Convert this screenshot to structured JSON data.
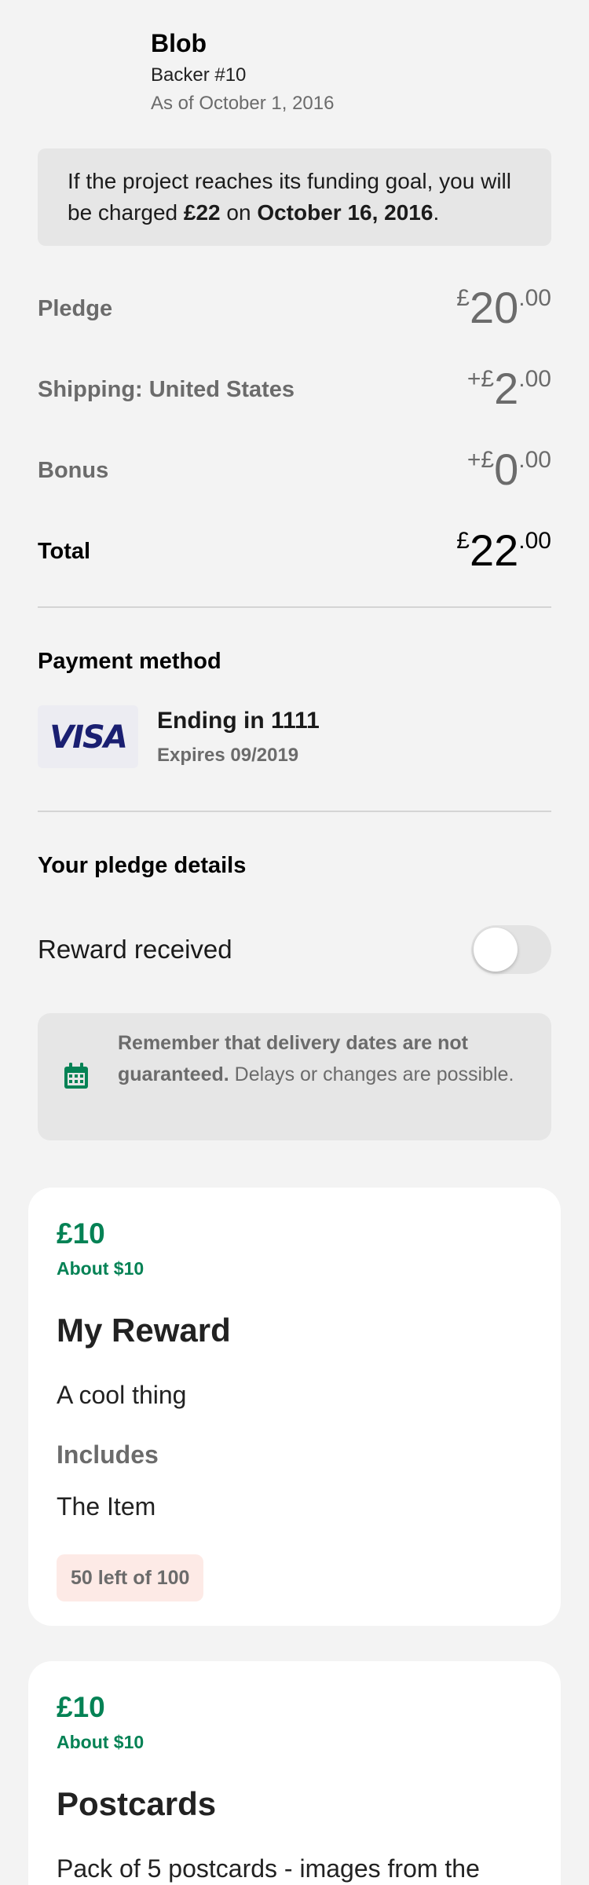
{
  "header": {
    "backer_name": "Blob",
    "backer_number": "Backer #10",
    "backer_date": "As of October 1, 2016"
  },
  "charge_notice": {
    "prefix": "If the project reaches its funding goal, you will be charged ",
    "amount": "£22",
    "middle": " on ",
    "date": "October 16, 2016",
    "suffix": "."
  },
  "summary": {
    "pledge": {
      "label": "Pledge",
      "currency": "£",
      "whole": "20",
      "decimal": ".00"
    },
    "shipping": {
      "label": "Shipping: United States",
      "currency": "+£",
      "whole": "2",
      "decimal": ".00"
    },
    "bonus": {
      "label": "Bonus",
      "currency": "+£",
      "whole": "0",
      "decimal": ".00"
    },
    "total": {
      "label": "Total",
      "currency": "£",
      "whole": "22",
      "decimal": ".00"
    }
  },
  "payment": {
    "title": "Payment method",
    "card_brand": "VISA",
    "ending": "Ending in 1111",
    "expiry": "Expires 09/2019"
  },
  "pledge_details": {
    "title": "Your pledge details",
    "reward_received_label": "Reward received",
    "reward_received": false
  },
  "delivery_notice": {
    "icon": "calendar-icon",
    "bold": "Remember that delivery dates are not guaranteed.",
    "rest": " Delays or changes are possible."
  },
  "rewards": [
    {
      "price": "£10",
      "converted": "About $10",
      "title": "My Reward",
      "description": "A cool thing",
      "includes_label": "Includes",
      "items": [
        "The Item"
      ],
      "limit": "50 left of 100"
    },
    {
      "price": "£10",
      "converted": "About $10",
      "title": "Postcards",
      "description": "Pack of 5 postcards - images from the"
    }
  ],
  "colors": {
    "accent_green": "#058255",
    "background": "#f3f3f3",
    "banner_gray": "#e6e6e6",
    "visa_blue": "#1a1f71"
  }
}
